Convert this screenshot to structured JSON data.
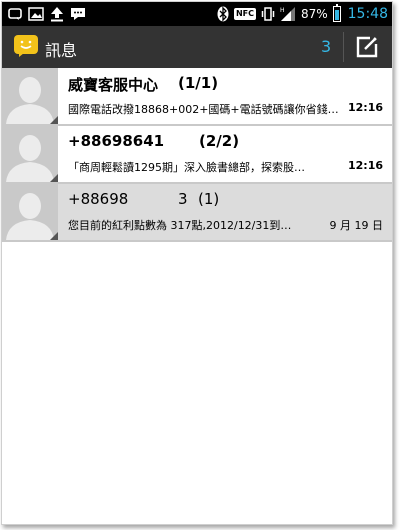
{
  "status_bar": {
    "nfc_label": "NFC",
    "battery_percent": "87%",
    "battery_level": 0.87,
    "time": "15:48",
    "accent_color": "#35b7e5",
    "left_icons": [
      "notification-icon",
      "image-icon",
      "upload-icon",
      "chat-icon"
    ],
    "right_icons": [
      "bluetooth-icon",
      "nfc-icon",
      "vibrate-icon",
      "signal-icon",
      "battery-icon"
    ]
  },
  "action_bar": {
    "title": "訊息",
    "unread_count": "3",
    "app_icon": "messaging-app-icon",
    "compose_icon": "compose-icon"
  },
  "conversations": [
    {
      "name": "威寶客服中心",
      "count": "(1/1)",
      "preview": "國際電話改撥18868+002+國碼+電話號碼讓你省錢…",
      "time": "12:16",
      "read": false
    },
    {
      "name": "+88698641",
      "count": "(2/2)",
      "preview": "「商周輕鬆讀1295期」深入臉書總部，探索股…",
      "time": "12:16",
      "read": false
    },
    {
      "name": "+88698",
      "name_suffix": "3",
      "count": "(1)",
      "preview": "您目前的紅利點數為 317點,2012/12/31到…",
      "time": "9 月 19 日",
      "read": true
    }
  ]
}
